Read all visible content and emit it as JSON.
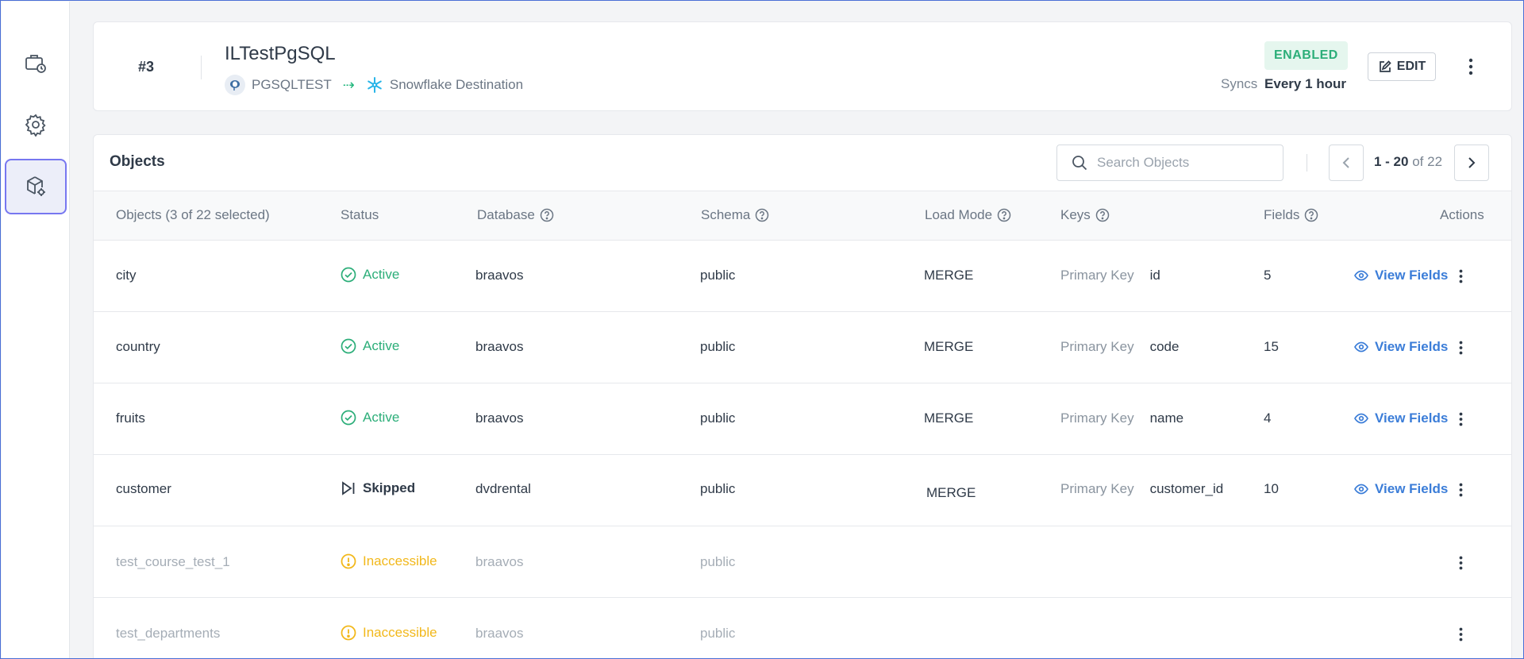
{
  "header": {
    "pipeline_id": "#3",
    "title": "ILTestPgSQL",
    "source": "PGSQLTEST",
    "destination": "Snowflake Destination",
    "status_badge": "ENABLED",
    "syncs_label": "Syncs",
    "syncs_value": "Every 1 hour",
    "edit_label": "EDIT"
  },
  "objects": {
    "title": "Objects",
    "search_placeholder": "Search Objects",
    "pagination": {
      "range": "1 - 20",
      "of_label": "of 22"
    },
    "columns": {
      "objects": "Objects (3 of 22 selected)",
      "status": "Status",
      "database": "Database",
      "schema": "Schema",
      "load_mode": "Load Mode",
      "keys": "Keys",
      "fields": "Fields",
      "actions": "Actions"
    },
    "rows": [
      {
        "name": "city",
        "status": "Active",
        "database": "braavos",
        "schema": "public",
        "load_mode": "MERGE",
        "key_label": "Primary Key",
        "key": "id",
        "fields": "5",
        "action": "View Fields"
      },
      {
        "name": "country",
        "status": "Active",
        "database": "braavos",
        "schema": "public",
        "load_mode": "MERGE",
        "key_label": "Primary Key",
        "key": "code",
        "fields": "15",
        "action": "View Fields"
      },
      {
        "name": "fruits",
        "status": "Active",
        "database": "braavos",
        "schema": "public",
        "load_mode": "MERGE",
        "key_label": "Primary Key",
        "key": "name",
        "fields": "4",
        "action": "View Fields"
      },
      {
        "name": "customer",
        "status": "Skipped",
        "database": "dvdrental",
        "schema": "public",
        "load_mode": "MERGE",
        "key_label": "Primary Key",
        "key": "customer_id",
        "fields": "10",
        "action": "View Fields"
      },
      {
        "name": "test_course_test_1",
        "status": "Inaccessible",
        "database": "braavos",
        "schema": "public"
      },
      {
        "name": "test_departments",
        "status": "Inaccessible",
        "database": "braavos",
        "schema": "public"
      }
    ]
  },
  "colors": {
    "active": "#2cae79",
    "inaccessible": "#f2b81b",
    "link": "#3b7dd8",
    "sidebar_active_border": "#7777f0"
  },
  "icons": {
    "sidebar": [
      "briefcase-clock-icon",
      "gear-icon",
      "cube-gear-icon"
    ]
  }
}
